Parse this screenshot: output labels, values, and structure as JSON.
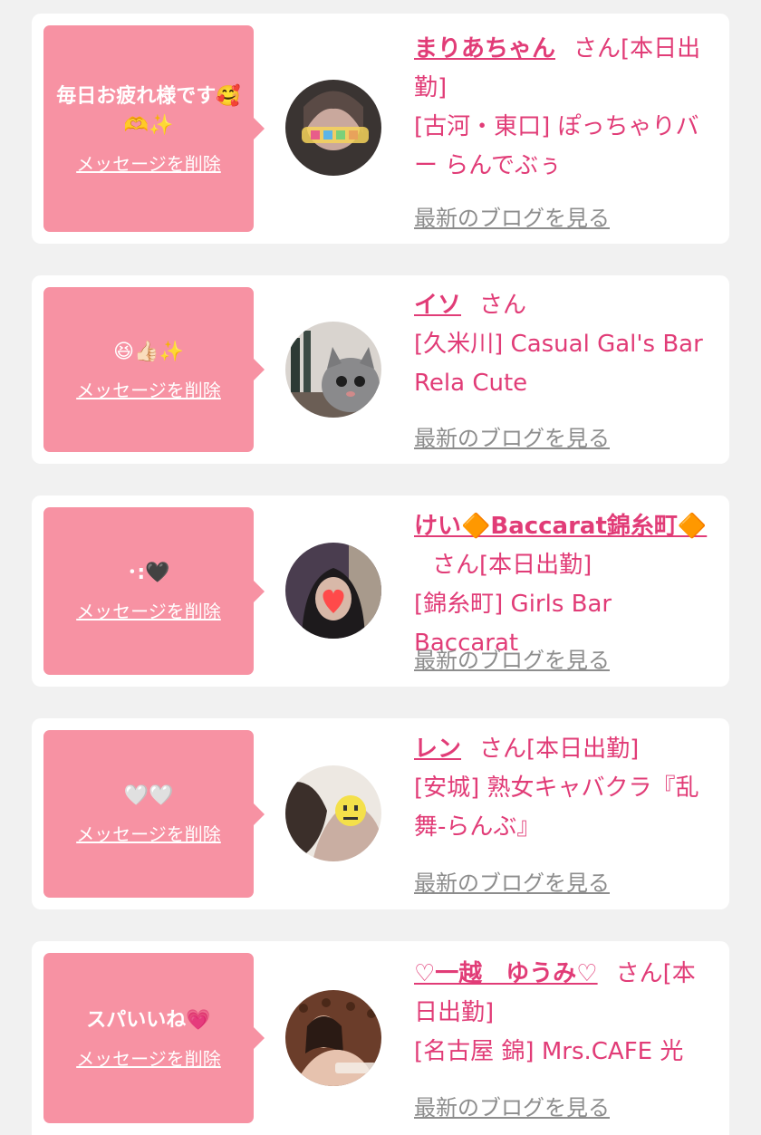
{
  "cards": [
    {
      "message": "毎日お疲れ様です🥰🫶✨",
      "delete_label": "メッセージを削除",
      "name": "まりあちゃん",
      "suffix": "さん[本日出勤]",
      "shop": "[古河・東口] ぽっちゃりバー らんでぶぅ",
      "blog_label": "最新のブログを見る",
      "avatar_icon": "avatar-happy-photo"
    },
    {
      "message": "😆👍🏻✨",
      "delete_label": "メッセージを削除",
      "name": "イソ",
      "suffix": "さん",
      "shop": "[久米川] Casual Gal's Bar Rela Cute",
      "blog_label": "最新のブログを見る",
      "avatar_icon": "avatar-cat-photo"
    },
    {
      "message": "･:🖤",
      "delete_label": "メッセージを削除",
      "name": "けい🔶Baccarat錦糸町🔶",
      "suffix": "さん[本日出勤]",
      "shop": "[錦糸町] Girls Bar Baccarat",
      "blog_label": "最新のブログを見る",
      "avatar_icon": "avatar-heart-face-photo"
    },
    {
      "message": "🤍🤍",
      "delete_label": "メッセージを削除",
      "name": "レン",
      "suffix": "さん[本日出勤]",
      "shop": "[安城] 熟女キャバクラ『乱舞-らんぶ』",
      "blog_label": "最新のブログを見る",
      "avatar_icon": "avatar-emoji-face-photo"
    },
    {
      "message": "スパいいね💗",
      "delete_label": "メッセージを削除",
      "name": "♡一越　ゆうみ♡",
      "suffix": "さん[本日出勤]",
      "shop": "[名古屋 錦] Mrs.CAFE 光",
      "blog_label": "最新のブログを見る",
      "avatar_icon": "avatar-sofa-photo"
    }
  ],
  "colors": {
    "background": "#f1f1f1",
    "bubble": "#f792a3",
    "accent": "#e13c77",
    "link_gray": "#8d8d8d"
  }
}
